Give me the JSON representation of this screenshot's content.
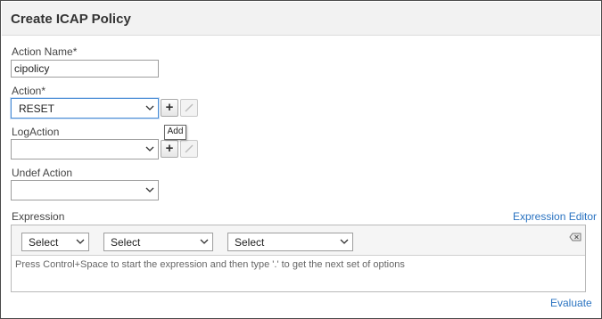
{
  "dialog": {
    "title": "Create ICAP Policy"
  },
  "form": {
    "action_name": {
      "label": "Action Name*",
      "value": "cipolicy"
    },
    "action": {
      "label": "Action*",
      "value": "RESET"
    },
    "log_action": {
      "label": "LogAction",
      "value": ""
    },
    "undef_action": {
      "label": "Undef Action",
      "value": ""
    },
    "add_button_glyph": "+",
    "tooltip": "Add"
  },
  "expression": {
    "label": "Expression",
    "editor_link": "Expression Editor",
    "selects": [
      "Select",
      "Select",
      "Select"
    ],
    "placeholder": "Press Control+Space to start the expression and then type '.' to get the next set of options",
    "evaluate_link": "Evaluate"
  },
  "icons": {
    "dropdown": "chevron-down-icon",
    "add": "plus-icon",
    "edit": "pencil-icon",
    "clear": "backspace-icon"
  },
  "colors": {
    "link": "#2a73c1",
    "focus": "#4c8fd6"
  }
}
